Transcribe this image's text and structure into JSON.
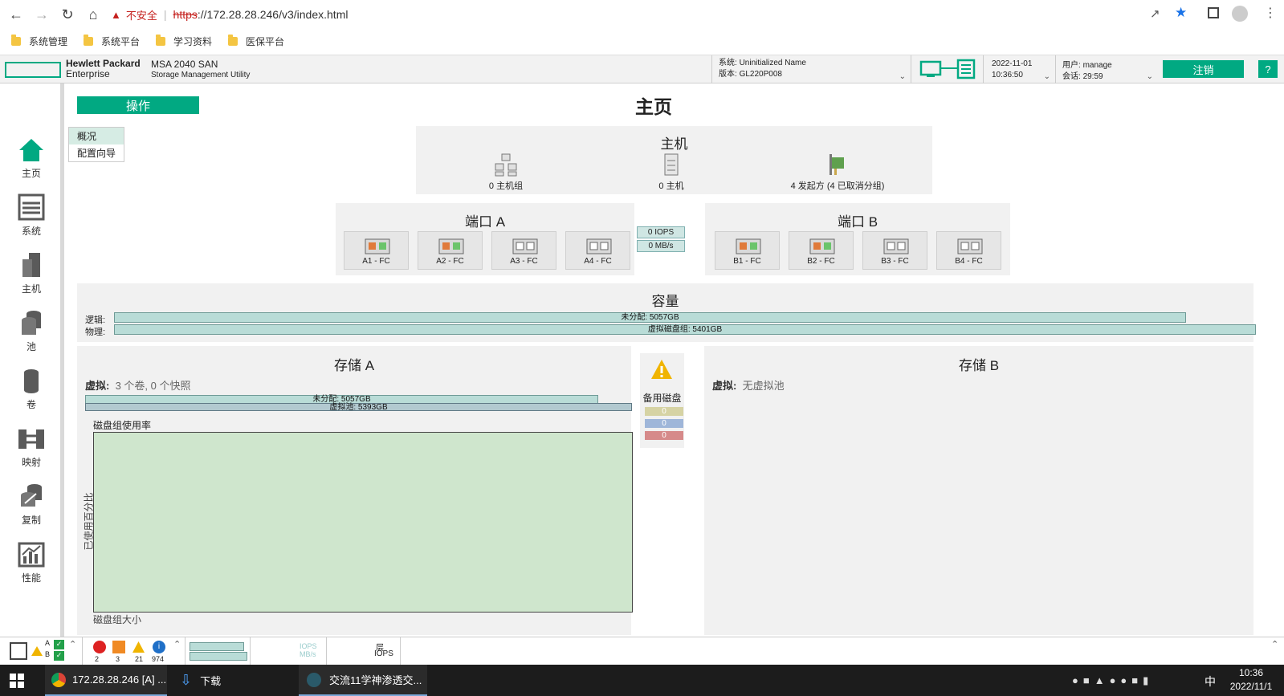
{
  "browser": {
    "insecure_label": "不安全",
    "url_scheme": "https",
    "url_rest": "://172.28.28.246/v3/index.html",
    "bookmarks": [
      "系统管理",
      "系统平台",
      "学习资料",
      "医保平台"
    ]
  },
  "header": {
    "brand_line1": "Hewlett Packard",
    "brand_line2": "Enterprise",
    "product": "MSA 2040 SAN",
    "product_sub": "Storage Management Utility",
    "system_label": "系统:",
    "system_value": "Uninitialized Name",
    "version_label": "版本:",
    "version_value": "GL220P008",
    "date": "2022-11-01",
    "time": "10:36:50",
    "user_label": "用户:",
    "user_value": "manage",
    "session_label": "会话:",
    "session_value": "29:59",
    "logout": "注销",
    "help": "?"
  },
  "sidebar": {
    "items": [
      {
        "label": "主页"
      },
      {
        "label": "系统"
      },
      {
        "label": "主机"
      },
      {
        "label": "池"
      },
      {
        "label": "卷"
      },
      {
        "label": "映射"
      },
      {
        "label": "复制"
      },
      {
        "label": "性能"
      }
    ]
  },
  "main": {
    "ops_button": "操作",
    "title": "主页",
    "submenu": [
      "概况",
      "配置向导"
    ],
    "hosts": {
      "title": "主机",
      "host_groups": "0 主机组",
      "hosts": "0 主机",
      "initiators": "4 发起方 (4 已取消分组)"
    },
    "port_a": {
      "title": "端口 A",
      "ports": [
        "A1 - FC",
        "A2 - FC",
        "A3 - FC",
        "A4 - FC"
      ]
    },
    "port_b": {
      "title": "端口 B",
      "ports": [
        "B1 - FC",
        "B2 - FC",
        "B3 - FC",
        "B4 - FC"
      ]
    },
    "iops": "0 IOPS",
    "mbs": "0 MB/s",
    "capacity": {
      "title": "容量",
      "logical_label": "逻辑:",
      "logical_bar": "未分配: 5057GB",
      "physical_label": "物理:",
      "physical_bar": "虚拟磁盘组: 5401GB"
    },
    "storage_a": {
      "title": "存储 A",
      "virtual_label": "虚拟:",
      "virtual_value": "3 个卷, 0 个快照",
      "bar1": "未分配: 5057GB",
      "bar2": "虚拟池: 5393GB",
      "chart_title": "磁盘组使用率",
      "y_label": "已使用百分比",
      "x_label": "磁盘组大小"
    },
    "spare": {
      "label": "备用磁盘",
      "values": [
        "0",
        "0",
        "0"
      ]
    },
    "storage_b": {
      "title": "存储 B",
      "virtual_label": "虚拟:",
      "virtual_value": "无虚拟池"
    }
  },
  "statusbar": {
    "ctrl_a": "A",
    "ctrl_b": "B",
    "counts": [
      "2",
      "3",
      "21",
      "974"
    ],
    "iops_label": "IOPS",
    "mbs_label": "MB/s",
    "layer_label": "层",
    "layer_iops": "IOPS"
  },
  "taskbar": {
    "chrome_task": "172.28.28.246 [A] ...",
    "download_task": "下载",
    "chat_task": "交流11学神渗透交...",
    "ime": "中",
    "time": "10:36",
    "date": "2022/11/1"
  },
  "colors": {
    "accent": "#01a982",
    "bar_teal": "#b9dcd7",
    "chart_green": "#cfe6cd",
    "spare_yellow": "#d6d3a4",
    "spare_blue": "#9fb6d9",
    "spare_red": "#d68a8a"
  }
}
